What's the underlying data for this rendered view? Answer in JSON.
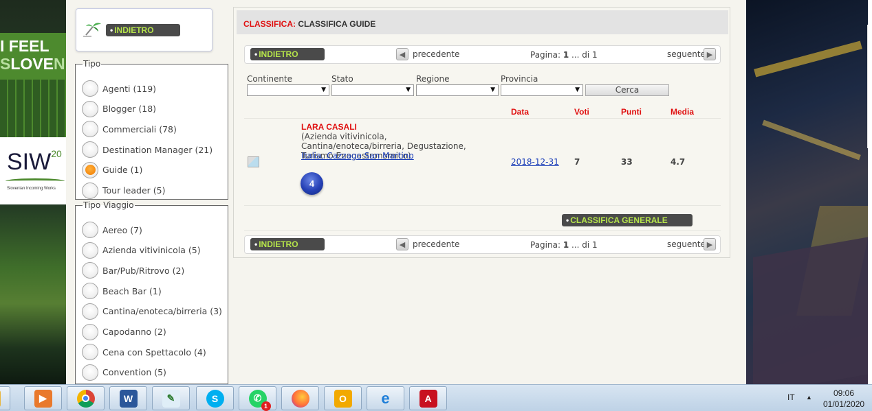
{
  "background": {
    "ifeel_line1": "I FEEL",
    "ifeel_line2a": "S",
    "ifeel_line2b": "LOVE",
    "ifeel_line2c": "NI",
    "siw_text": "SIW",
    "siw_sup": "20",
    "siw_sub": "Slovenian Incoming Works"
  },
  "sidebar": {
    "back_label": "INDIETRO",
    "tipo": {
      "legend": "Tipo",
      "items": [
        {
          "label": "Agenti (119)",
          "selected": false
        },
        {
          "label": "Blogger (18)",
          "selected": false
        },
        {
          "label": "Commerciali (78)",
          "selected": false
        },
        {
          "label": "Destination Manager (21)",
          "selected": false
        },
        {
          "label": "Guide (1)",
          "selected": true
        },
        {
          "label": "Tour leader (5)",
          "selected": false
        }
      ]
    },
    "tipo_viaggio": {
      "legend": "Tipo Viaggio",
      "items": [
        {
          "label": "Aereo (7)"
        },
        {
          "label": "Azienda vitivinicola (5)"
        },
        {
          "label": "Bar/Pub/Ritrovo (2)"
        },
        {
          "label": "Beach Bar (1)"
        },
        {
          "label": "Cantina/enoteca/birreria (3)"
        },
        {
          "label": "Capodanno (2)"
        },
        {
          "label": "Cena con Spettacolo (4)"
        },
        {
          "label": "Convention (5)"
        }
      ]
    }
  },
  "main": {
    "title_prefix": "CLASSIFICA:",
    "title": "CLASSIFICA GUIDE",
    "nav": {
      "back": "INDIETRO",
      "prev": "precedente",
      "page_label": "Pagina:",
      "page_current": "1",
      "page_of": "... di 1",
      "next": "seguente"
    },
    "filters": {
      "continente": "Continente",
      "stato": "Stato",
      "regione": "Regione",
      "provincia": "Provincia",
      "search_button": "Cerca"
    },
    "columns": {
      "data": "Data",
      "voti": "Voti",
      "punti": "Punti",
      "media": "Media"
    },
    "row": {
      "name": "LARA CASALI",
      "categories": "(Azienda vitivinicola, Cantina/enoteca/birreria, Degustazione, Turismo Enogastronomico)",
      "location": "Italia, Cazzago San Martino",
      "badge": "4",
      "date": "2018-12-31",
      "voti": "7",
      "punti": "33",
      "media": "4.7"
    },
    "general_ranking_button": "CLASSIFICA GENERALE"
  },
  "taskbar": {
    "apps": [
      "file-explorer-icon",
      "media-player-icon",
      "chrome-icon",
      "word-icon",
      "feather-icon",
      "skype-icon",
      "whatsapp-icon",
      "firefox-icon",
      "outlook-icon",
      "internet-explorer-icon",
      "acrobat-icon"
    ],
    "whatsapp_badge": "1",
    "lang": "IT",
    "time": "09:06",
    "date": "01/01/2020"
  },
  "colors": {
    "accent_red": "#e01010",
    "pill_green": "#b5e34a",
    "radio_orange": "#f07a00"
  }
}
